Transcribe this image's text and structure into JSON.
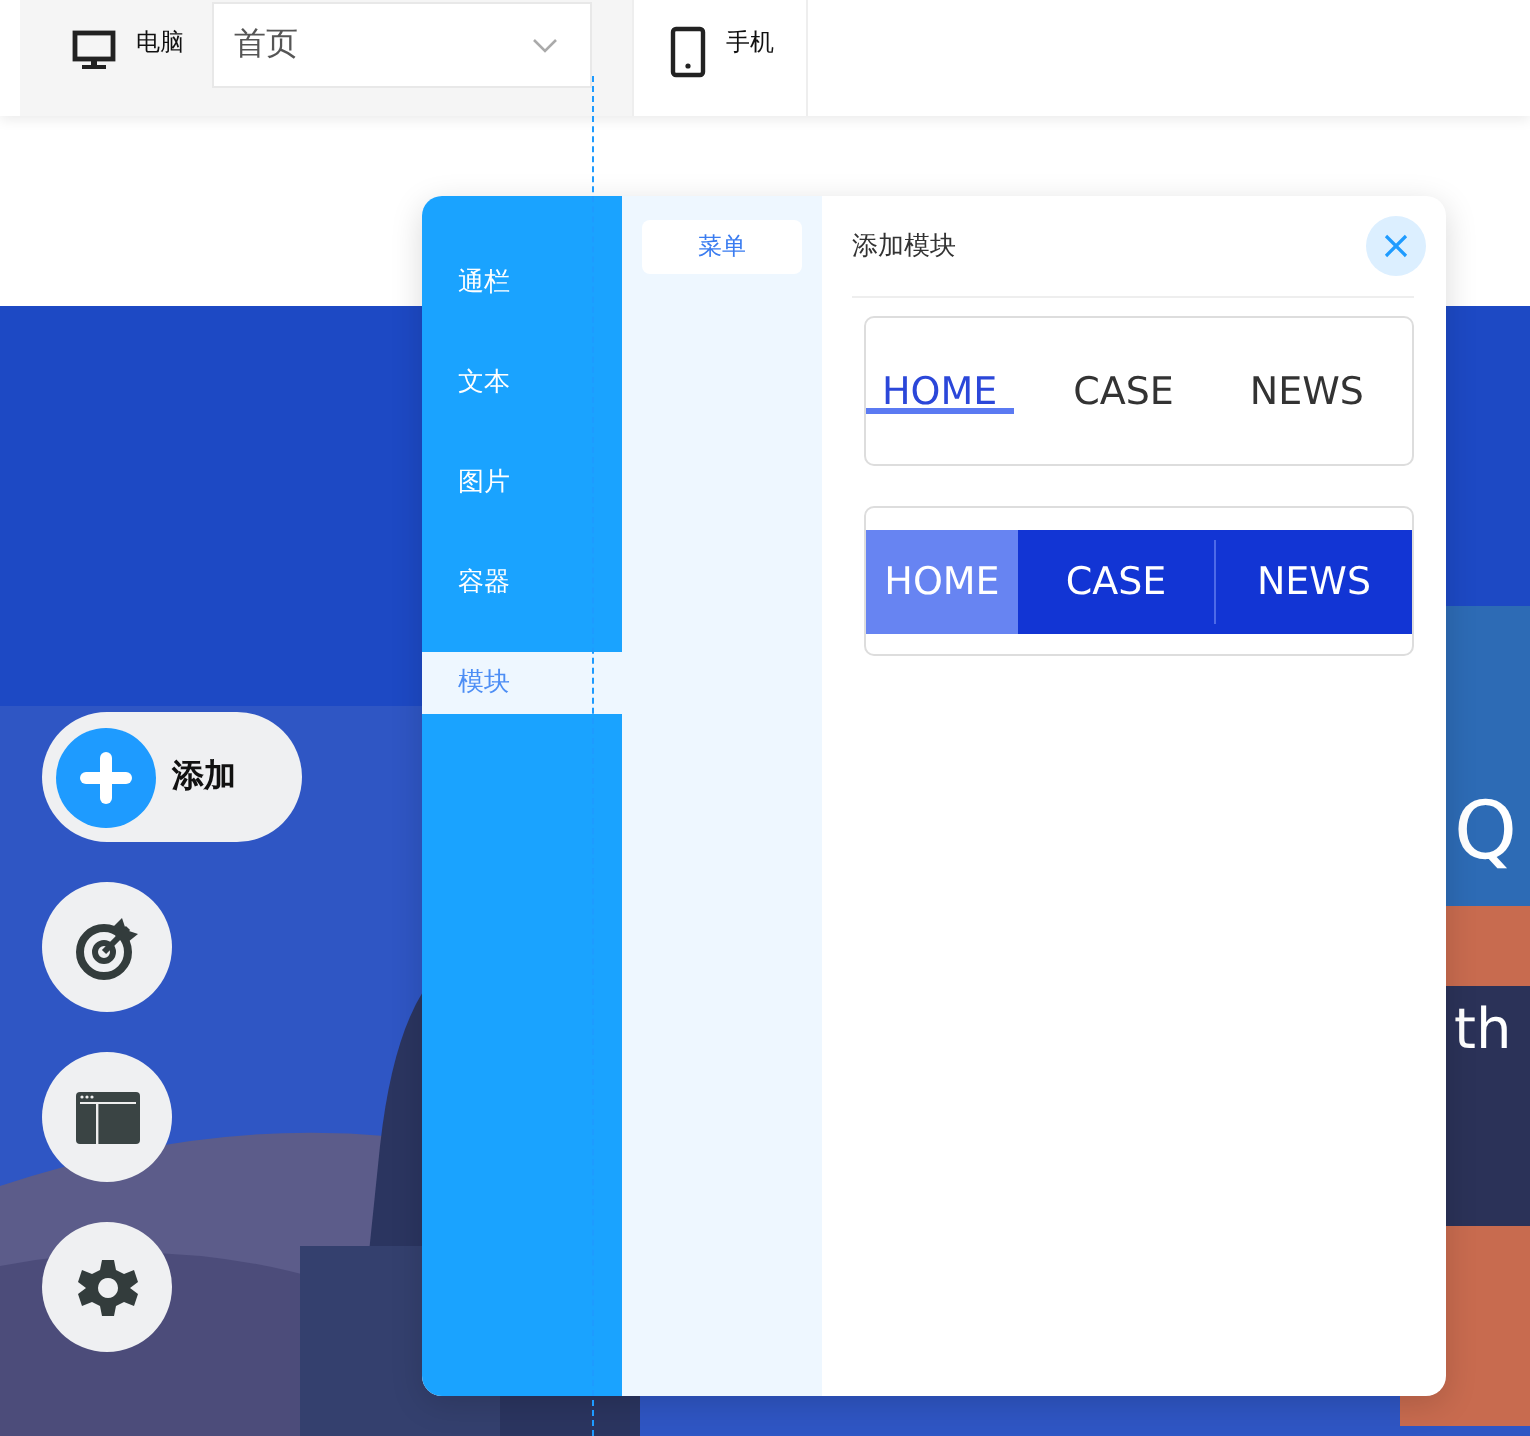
{
  "toolbar": {
    "devices": [
      {
        "kind": "desktop",
        "label": "电脑",
        "selected": true
      },
      {
        "kind": "mobile",
        "label": "手机",
        "selected": false
      }
    ],
    "page_select": {
      "value": "首页"
    }
  },
  "hero": {
    "headline": "Q",
    "subline": "th"
  },
  "float_buttons": [
    {
      "kind": "add",
      "label": "添加"
    },
    {
      "kind": "target"
    },
    {
      "kind": "layout"
    },
    {
      "kind": "settings"
    }
  ],
  "panel": {
    "categories": [
      {
        "label": "通栏",
        "selected": false
      },
      {
        "label": "文本",
        "selected": false
      },
      {
        "label": "图片",
        "selected": false
      },
      {
        "label": "容器",
        "selected": false
      },
      {
        "label": "模块",
        "selected": true
      }
    ],
    "subcategories": [
      {
        "label": "菜单",
        "selected": true
      }
    ],
    "title": "添加模块",
    "templates": [
      {
        "kind": "underline",
        "items": [
          {
            "label": "HOME",
            "selected": true
          },
          {
            "label": "CASE",
            "selected": false
          },
          {
            "label": "NEWS",
            "selected": false
          }
        ]
      },
      {
        "kind": "filled",
        "items": [
          {
            "label": "HOME",
            "selected": true
          },
          {
            "label": "CASE",
            "selected": false
          },
          {
            "label": "NEWS",
            "selected": false
          }
        ]
      }
    ]
  }
}
